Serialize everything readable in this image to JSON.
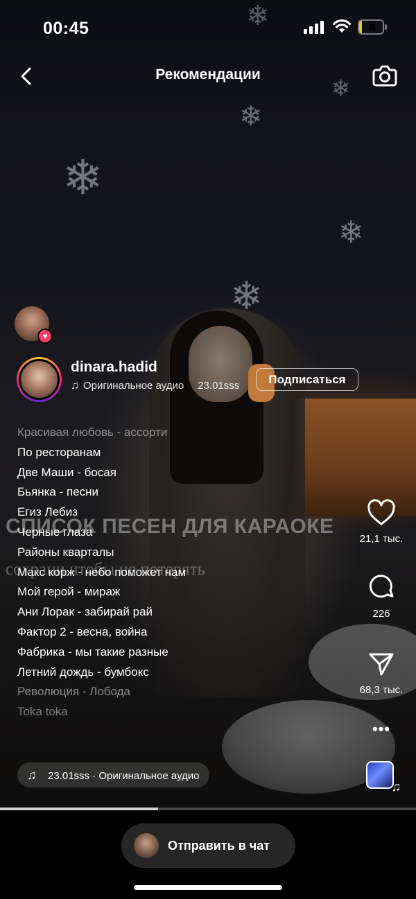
{
  "status_bar": {
    "time": "00:45",
    "battery": "8",
    "battery_level": 0.08
  },
  "header": {
    "title": "Рекомендации",
    "back_icon": "chevron-left-icon",
    "camera_icon": "camera-icon"
  },
  "post": {
    "username": "dinara.hadid",
    "audio_label": "Оригинальное аудио",
    "audio_author": "23.01sss",
    "follow_label": "Подписаться",
    "overlay_title": "СПИСОК ПЕСЕН ДЛЯ КАРАОКЕ",
    "overlay_subtitle": "сохрани чтобы не потерять",
    "songs": [
      "Красивая любовь - ассорти",
      "По ресторанам",
      "Две Маши - босая",
      "Бьянка - песни",
      "Егиз Лебиз",
      "Черные глаза",
      "Районы кварталы",
      " Макс корж - небо поможет нам",
      "Мой герой - мираж",
      "Ани Лорак - забирай рай",
      " Фактор 2 - весна, война",
      "Фабрика - мы такие разные",
      "Летний дождь - бумбокс",
      "Революция - Лобода",
      "Toka toka"
    ],
    "audio_pill": "23.01sss · Оригинальное аудио"
  },
  "actions": {
    "likes": "21,1 тыс.",
    "comments": "226",
    "shares": "68,3 тыс.",
    "more": "•••"
  },
  "progress": {
    "fraction": 0.38
  },
  "bottom": {
    "send_chat_label": "Отправить в чат"
  }
}
